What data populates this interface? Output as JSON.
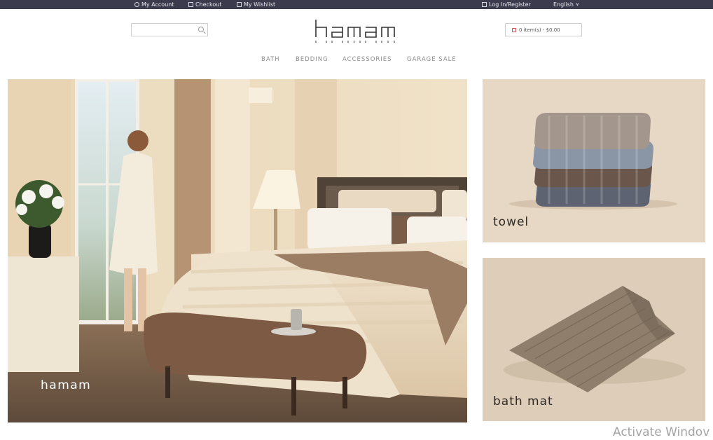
{
  "topbar": {
    "my_account": "My Account",
    "checkout": "Checkout",
    "my_wishlist": "My Wishlist",
    "login_register": "Log In/Register",
    "language": "English",
    "language_caret": "∨"
  },
  "header": {
    "search_placeholder": "",
    "logo_text": "hamam",
    "cart_summary": "0 item(s) - $0.00"
  },
  "nav": {
    "items": [
      "BATH",
      "BEDDING",
      "ACCESSORIES",
      "GARAGE SALE"
    ]
  },
  "banners": {
    "hero_label": "hamam",
    "towel_label": "towel",
    "bath_mat_label": "bath mat"
  },
  "system": {
    "watermark": "Activate Windov"
  },
  "colors": {
    "topbar": "#3c3b4e",
    "towel_bg": "#e7d8c5",
    "bath_mat_bg": "#ddcdb9",
    "nav_text": "#8c8c8c"
  }
}
